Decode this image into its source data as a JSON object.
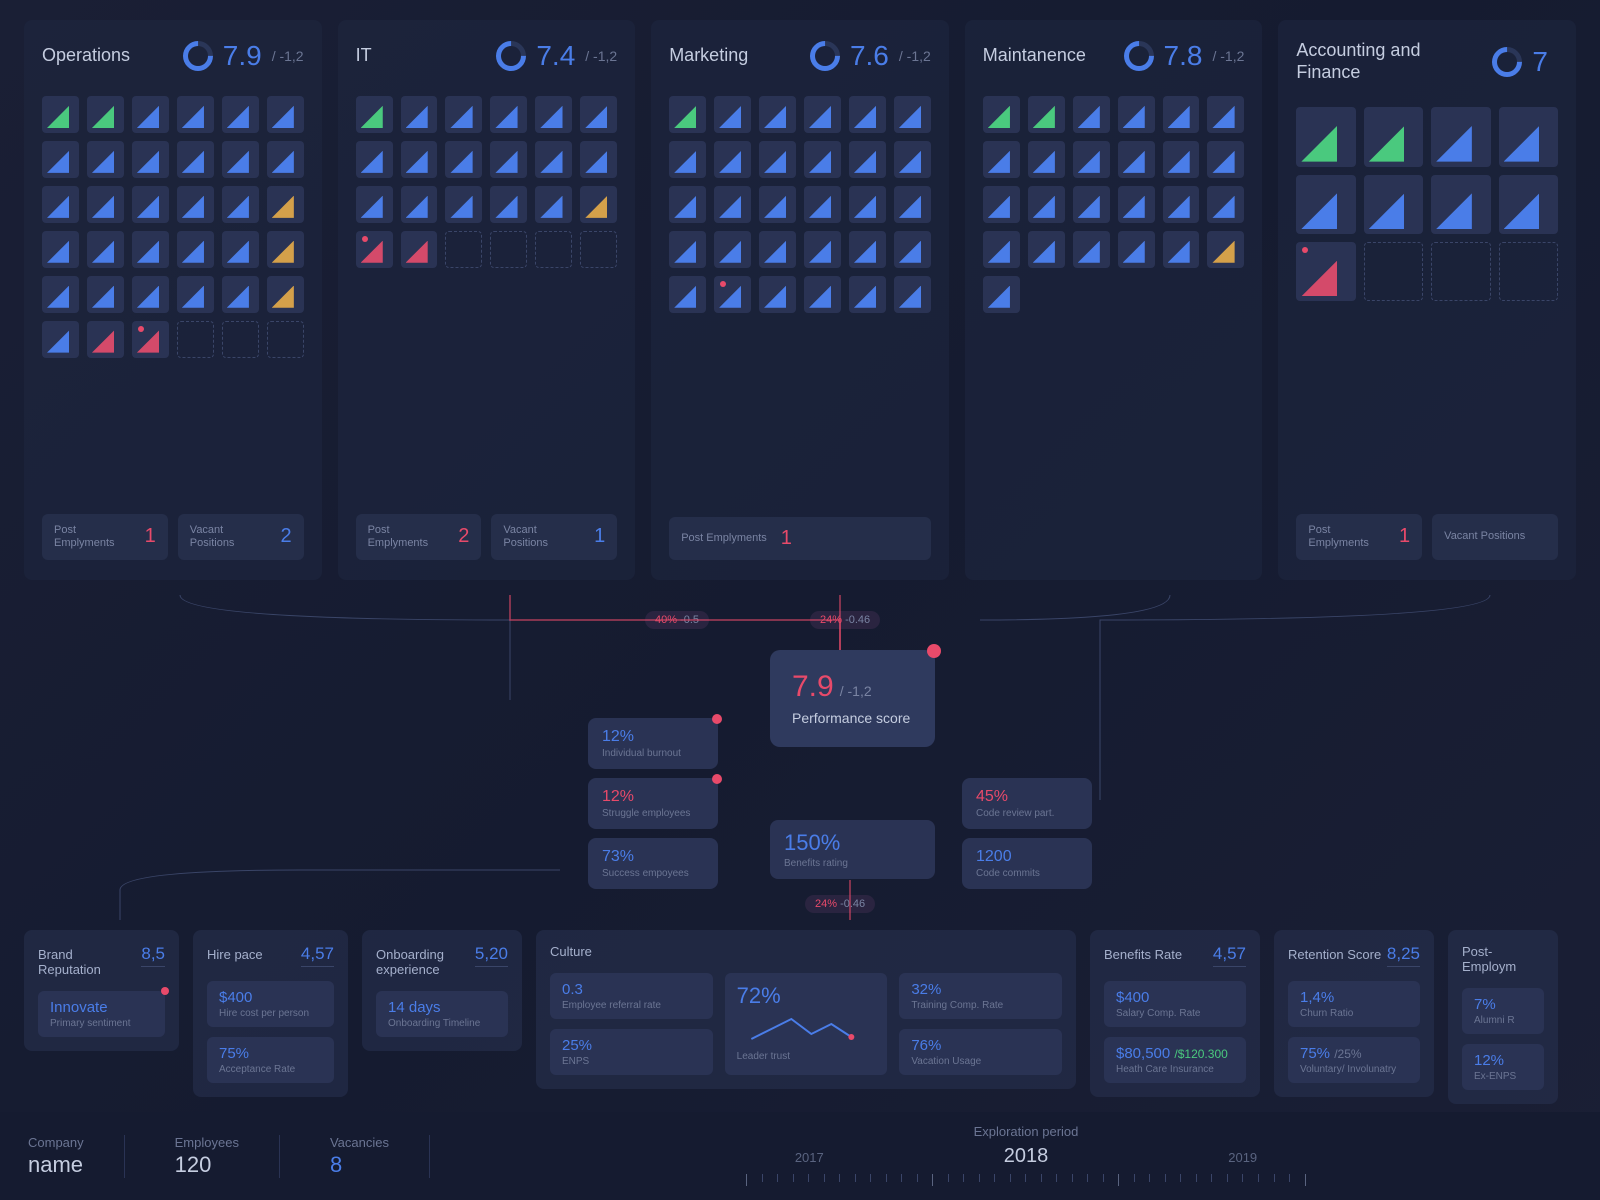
{
  "departments": [
    {
      "name": "Operations",
      "score": "7.9",
      "delta": "/ -1,2",
      "tiles": [
        "green",
        "green",
        "blue",
        "blue",
        "blue",
        "blue",
        "blue",
        "blue",
        "blue",
        "blue",
        "blue",
        "blue",
        "blue",
        "blue",
        "blue",
        "blue",
        "blue",
        "orange",
        "blue",
        "blue",
        "blue",
        "blue",
        "blue",
        "orange",
        "blue",
        "blue",
        "blue",
        "blue",
        "blue",
        "orange",
        "blue",
        "red",
        "red-dot red",
        "empty",
        "empty",
        "empty"
      ],
      "post": "1",
      "vacant": "2"
    },
    {
      "name": "IT",
      "score": "7.4",
      "delta": "/ -1,2",
      "tiles": [
        "green",
        "blue",
        "blue",
        "blue",
        "blue",
        "blue",
        "blue",
        "blue",
        "blue",
        "blue",
        "blue",
        "blue",
        "blue",
        "blue",
        "blue",
        "blue",
        "blue",
        "orange",
        "red-dot red",
        "red",
        "empty",
        "empty",
        "empty",
        "empty"
      ],
      "post": "2",
      "vacant": "1"
    },
    {
      "name": "Marketing",
      "score": "7.6",
      "delta": "/ -1,2",
      "tiles": [
        "green",
        "blue",
        "blue",
        "blue",
        "blue",
        "blue",
        "blue",
        "blue",
        "blue",
        "blue",
        "blue",
        "blue",
        "blue",
        "blue",
        "blue",
        "blue",
        "blue",
        "blue",
        "blue",
        "blue",
        "blue",
        "blue",
        "blue",
        "blue",
        "blue",
        "red-dot blue",
        "blue",
        "blue",
        "blue",
        "blue"
      ],
      "post": "1",
      "vacant": null
    },
    {
      "name": "Maintanence",
      "score": "7.8",
      "delta": "/ -1,2",
      "tiles": [
        "green",
        "green",
        "blue",
        "blue",
        "blue",
        "blue",
        "blue",
        "blue",
        "blue",
        "blue",
        "blue",
        "blue",
        "blue",
        "blue",
        "blue",
        "blue",
        "blue",
        "blue",
        "blue",
        "blue",
        "blue",
        "blue",
        "blue",
        "orange",
        "blue"
      ],
      "post": null,
      "vacant": null
    },
    {
      "name": "Accounting and Finance",
      "score": "7",
      "delta": "",
      "tiles": [
        "green",
        "green",
        "blue",
        "blue",
        "blue",
        "blue",
        "blue",
        "blue",
        "red-dot red",
        "empty",
        "empty",
        "empty"
      ],
      "post": "1",
      "vacant": ""
    }
  ],
  "footer_labels": {
    "post": "Post\nEmplyments",
    "vacant": "Vacant\nPositions"
  },
  "flow_tags": {
    "a": {
      "pct": "40%",
      "dlt": "-0.5"
    },
    "b": {
      "pct": "24%",
      "dlt": "-0.46"
    },
    "c": {
      "pct": "24%",
      "dlt": "-0.46"
    }
  },
  "performance": {
    "score": "7.9",
    "delta": "/ -1,2",
    "label": "Performance score"
  },
  "center_metrics": {
    "burnout": {
      "val": "12%",
      "label": "Individual burnout"
    },
    "struggle": {
      "val": "12%",
      "label": "Struggle employees"
    },
    "success": {
      "val": "73%",
      "label": "Success empoyees"
    },
    "benefits": {
      "val": "150%",
      "label": "Benefits rating"
    },
    "code_review": {
      "val": "45%",
      "label": "Code review part."
    },
    "commits": {
      "val": "1200",
      "label": "Code commits"
    }
  },
  "bottom": {
    "brand": {
      "title": "Brand\nReputation",
      "score": "8,5",
      "m1": {
        "val": "Innovate",
        "label": "Primary sentiment"
      }
    },
    "hire": {
      "title": "Hire pace",
      "score": "4,57",
      "m1": {
        "val": "$400",
        "label": "Hire cost per person"
      },
      "m2": {
        "val": "75%",
        "label": "Acceptance Rate"
      }
    },
    "onboard": {
      "title": "Onboarding experience",
      "score": "5,20",
      "m1": {
        "val": "14 days",
        "label": "Onboarding Timeline"
      }
    },
    "culture": {
      "title": "Culture",
      "m1": {
        "val": "0.3",
        "label": "Employee referral rate"
      },
      "m2": {
        "val": "25%",
        "label": "ENPS"
      },
      "trust": {
        "val": "72%",
        "label": "Leader trust"
      },
      "m3": {
        "val": "32%",
        "label": "Training Comp. Rate"
      },
      "m4": {
        "val": "76%",
        "label": "Vacation Usage"
      }
    },
    "benefits": {
      "title": "Benefits Rate",
      "score": "4,57",
      "m1": {
        "val": "$400",
        "label": "Salary Comp. Rate"
      },
      "m2": {
        "val": "$80,500",
        "sec": "/$120.300",
        "label": "Heath Care Insurance"
      }
    },
    "retention": {
      "title": "Retention Score",
      "score": "8,25",
      "m1": {
        "val": "1,4%",
        "label": "Churn Ratio"
      },
      "m2": {
        "val": "75%",
        "sec": "/25%",
        "label": "Voluntary/ Involunatry"
      }
    },
    "post": {
      "title": "Post-Employm",
      "m1": {
        "val": "7%",
        "label": "Alumni R"
      },
      "m2": {
        "val": "12%",
        "label": "Ex-ENPS"
      }
    }
  },
  "bottombar": {
    "company": {
      "label": "Company",
      "val": "name"
    },
    "employees": {
      "label": "Employees",
      "val": "120"
    },
    "vacancies": {
      "label": "Vacancies",
      "val": "8"
    },
    "period": {
      "label": "Exploration period",
      "years": [
        "2017",
        "2018",
        "2019"
      ]
    }
  }
}
